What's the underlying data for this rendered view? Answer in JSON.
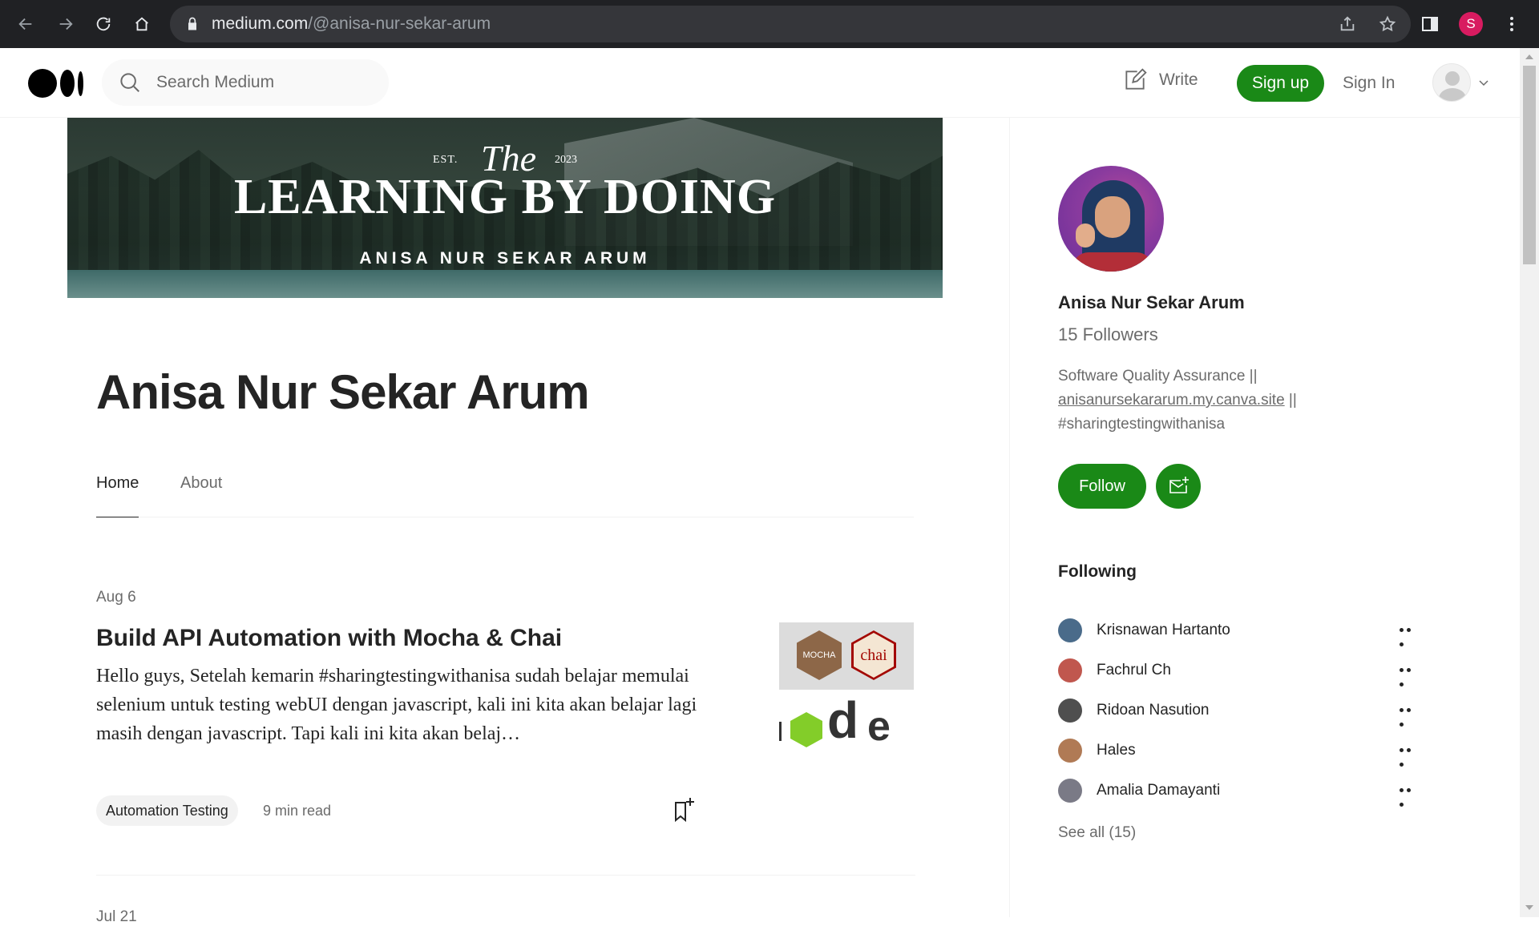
{
  "browser": {
    "url_host": "medium.com",
    "url_path": "/@anisa-nur-sekar-arum",
    "profile_initial": "S"
  },
  "header": {
    "search_placeholder": "Search Medium",
    "write_label": "Write",
    "signup_label": "Sign up",
    "signin_label": "Sign In"
  },
  "banner": {
    "est": "EST.",
    "the": "The",
    "year": "2023",
    "title": "LEARNING BY DOING",
    "subtitle": "ANISA NUR SEKAR ARUM"
  },
  "profile": {
    "name": "Anisa Nur Sekar Arum",
    "tabs": [
      {
        "label": "Home",
        "active": true
      },
      {
        "label": "About",
        "active": false
      }
    ]
  },
  "articles": [
    {
      "date": "Aug 6",
      "title": "Build API Automation with Mocha & Chai",
      "excerpt": "Hello guys, Setelah kemarin #sharingtestingwithanisa sudah belajar memulai selenium untuk testing webUI dengan javascript, kali ini kita akan belajar lagi masih dengan javascript. Tapi kali ini kita akan belaj…",
      "tag": "Automation Testing",
      "read_time": "9 min read",
      "thumb": {
        "mocha": "MOCHA",
        "chai": "chai",
        "node_d": "d",
        "node_e": "e"
      }
    },
    {
      "date": "Jul 21"
    }
  ],
  "sidebar": {
    "name": "Anisa Nur Sekar Arum",
    "followers": "15 Followers",
    "bio_line1": "Software Quality Assurance ||",
    "bio_link": "anisanursekararum.my.canva.site",
    "bio_after_link": " ||",
    "bio_line3": "#sharingtestingwithanisa",
    "follow_label": "Follow",
    "following_heading": "Following",
    "following": [
      {
        "name": "Krisnawan Hartanto",
        "color": "#4a6b8a"
      },
      {
        "name": "Fachrul Ch",
        "color": "#c0574e"
      },
      {
        "name": "Ridoan Nasution",
        "color": "#4f4f4f"
      },
      {
        "name": "Hales",
        "color": "#b07a55"
      },
      {
        "name": "Amalia Damayanti",
        "color": "#7a7a86"
      }
    ],
    "see_all": "See all (15)"
  },
  "colors": {
    "accent_green": "#1a8917",
    "text_primary": "#242424",
    "text_secondary": "#6b6b6b"
  }
}
